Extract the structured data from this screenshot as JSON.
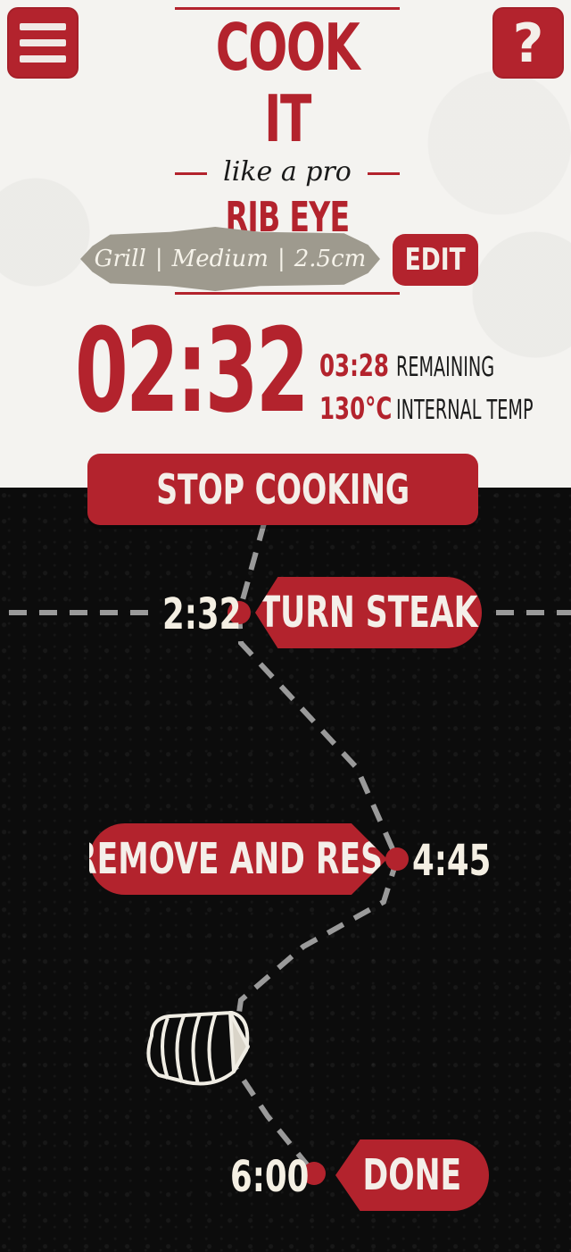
{
  "header": {
    "menu_icon": "hamburger-menu-icon",
    "help_label": "?",
    "logo": {
      "title": "COOK IT",
      "subtitle": "like a pro",
      "dish": "RIB EYE STEAK"
    }
  },
  "settings": {
    "method": "Grill",
    "doneness": "Medium",
    "thickness": "2.5cm",
    "separator": "|",
    "edit_label": "EDIT"
  },
  "timer": {
    "elapsed": "02:32",
    "remaining_value": "03:28",
    "remaining_label": "REMAINING",
    "temp_value": "130°C",
    "temp_label": "INTERNAL TEMP"
  },
  "actions": {
    "stop_label": "STOP COOKING"
  },
  "timeline": {
    "steps": [
      {
        "time": "2:32",
        "label": "TURN STEAK"
      },
      {
        "time": "4:45",
        "label": "REMOVE AND REST"
      },
      {
        "time": "6:00",
        "label": "DONE"
      }
    ],
    "illustration": "sliced-steak-icon"
  },
  "colors": {
    "accent_red": "#b3232d",
    "chalkboard": "#0c0c0c",
    "paper": "#f4f3f0",
    "tag_grey": "#9e9a8e"
  }
}
